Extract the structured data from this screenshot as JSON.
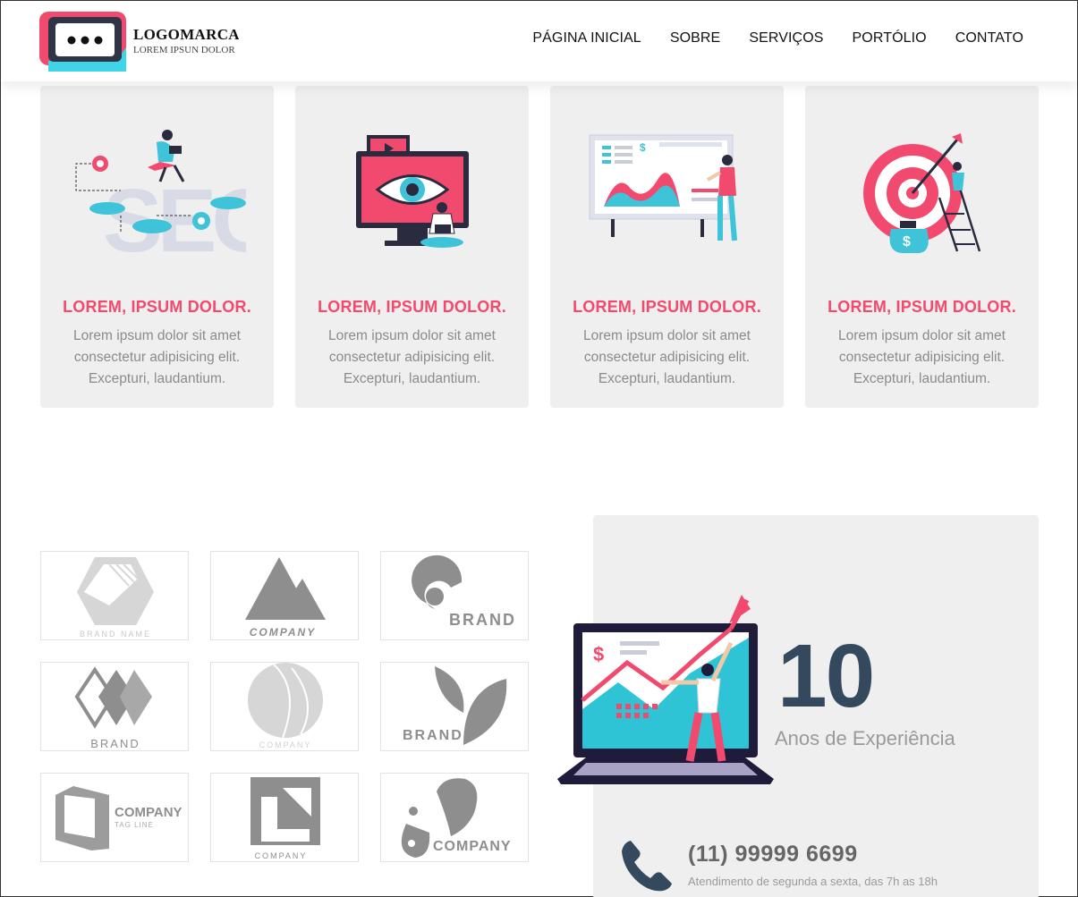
{
  "brand": {
    "title": "LOGOMARCA",
    "subtitle": "LOREM IPSUN DOLOR"
  },
  "nav": {
    "items": [
      {
        "label": "PÁGINA INICIAL"
      },
      {
        "label": "SOBRE"
      },
      {
        "label": "SERVIÇOS"
      },
      {
        "label": "PORTÓLIO"
      },
      {
        "label": "CONTATO"
      }
    ]
  },
  "services": [
    {
      "icon": "seo-illustration-icon",
      "title": "LOREM, IPSUM DOLOR.",
      "text": "Lorem ipsum dolor sit amet consectetur adipisicing elit. Excepturi, laudantium."
    },
    {
      "icon": "eye-monitor-illustration-icon",
      "title": "LOREM, IPSUM DOLOR.",
      "text": "Lorem ipsum dolor sit amet consectetur adipisicing elit. Excepturi, laudantium."
    },
    {
      "icon": "presentation-chart-illustration-icon",
      "title": "LOREM, IPSUM DOLOR.",
      "text": "Lorem ipsum dolor sit amet consectetur adipisicing elit. Excepturi, laudantium."
    },
    {
      "icon": "target-goal-illustration-icon",
      "title": "LOREM, IPSUM DOLOR.",
      "text": "Lorem ipsum dolor sit amet consectetur adipisicing elit. Excepturi, laudantium."
    }
  ],
  "clients": {
    "logos": [
      {
        "name": "hexagon-brand-logo",
        "text": "BRAND NAME"
      },
      {
        "name": "mountain-company-logo",
        "text": "COMPANY"
      },
      {
        "name": "swirl-brand-logo",
        "text": "BRAND"
      },
      {
        "name": "diamond-brand-logo",
        "text": "BRAND"
      },
      {
        "name": "circle-company-logo",
        "text": "COMPANY"
      },
      {
        "name": "leaf-brand-logo",
        "text": "BRAND"
      },
      {
        "name": "cube-company-logo",
        "text": "COMPANY",
        "tagline": "TAG LINE"
      },
      {
        "name": "square-company-logo",
        "text": "COMPANY"
      },
      {
        "name": "drop-company-logo",
        "text": "COMPANY"
      }
    ]
  },
  "experience": {
    "number": "10",
    "label": "Anos de Experiência",
    "phone": "(11) 99999 6699",
    "hours": "Atendimento de segunda a sexta, das 7h as 18h"
  },
  "colors": {
    "accent": "#f24a6e",
    "teal": "#2ec4d6",
    "navy": "#34495e",
    "card_bg": "#efefef",
    "muted_text": "#8b8b8b"
  }
}
